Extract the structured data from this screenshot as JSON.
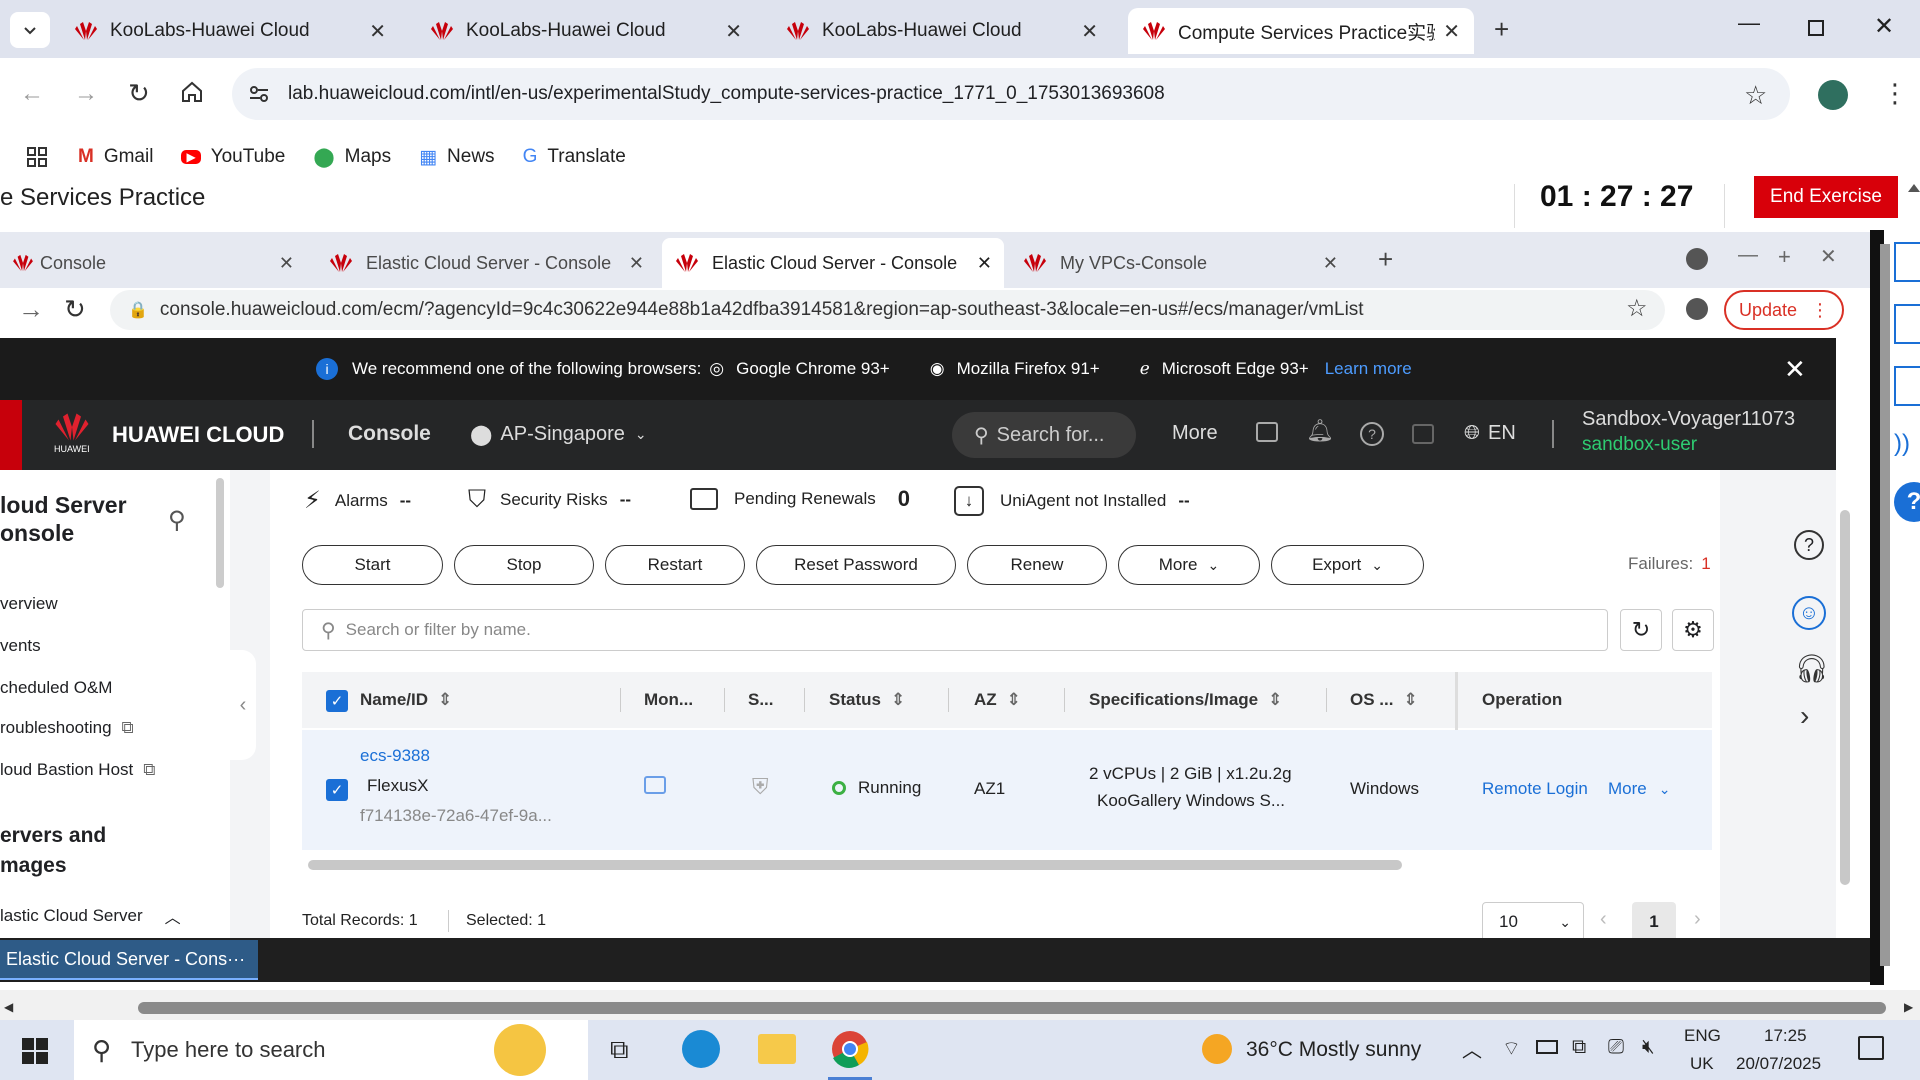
{
  "outer_tabs": [
    {
      "title": "KooLabs-Huawei Cloud"
    },
    {
      "title": "KooLabs-Huawei Cloud"
    },
    {
      "title": "KooLabs-Huawei Cloud"
    },
    {
      "title": "Compute Services Practice实验"
    }
  ],
  "outer_url": "lab.huaweicloud.com/intl/en-us/experimentalStudy_compute-services-practice_1771_0_1753013693608",
  "bookmarks": [
    "Gmail",
    "YouTube",
    "Maps",
    "News",
    "Translate"
  ],
  "lab": {
    "title": "e Services Practice",
    "timer": "01 : 27 : 27",
    "end_button": "End Exercise"
  },
  "inner_tabs": [
    {
      "title": "Console"
    },
    {
      "title": "Elastic Cloud Server - Console"
    },
    {
      "title": "Elastic Cloud Server - Console"
    },
    {
      "title": "My VPCs-Console"
    }
  ],
  "inner_url": "console.huaweicloud.com/ecm/?agencyId=9c4c30622e944e88b1a42dfba3914581&region=ap-southeast-3&locale=en-us#/ecs/manager/vmList",
  "update_label": "Update",
  "recommend": {
    "text": "We recommend one of the following browsers:",
    "browsers": [
      "Google Chrome 93+",
      "Mozilla Firefox 91+",
      "Microsoft Edge 93+"
    ],
    "learn_more": "Learn more"
  },
  "hwnav": {
    "brand": "HUAWEI CLOUD",
    "logo_text": "HUAWEI",
    "console": "Console",
    "region": "AP-Singapore",
    "search": "Search for...",
    "more": "More",
    "lang": "EN",
    "account": "Sandbox-Voyager11073",
    "user": "sandbox-user"
  },
  "sidebar": {
    "title_line1": "loud Server",
    "title_line2": "onsole",
    "items": [
      "verview",
      "vents",
      "cheduled O&M",
      "roubleshooting",
      "loud Bastion Host"
    ],
    "section_line1": "ervers and",
    "section_line2": "mages",
    "sub": "lastic Cloud Server"
  },
  "summary": {
    "alarms": "Alarms",
    "alarms_val": "--",
    "security": "Security Risks",
    "security_val": "--",
    "renewals": "Pending Renewals",
    "renewals_val": "0",
    "agent": "UniAgent not Installed",
    "agent_val": "--"
  },
  "buttons": [
    "Start",
    "Stop",
    "Restart",
    "Reset Password",
    "Renew",
    "More",
    "Export"
  ],
  "failures_label": "Failures:",
  "failures_val": "1",
  "filter_placeholder": "Search or filter by name.",
  "columns": [
    "Name/ID",
    "Mon...",
    "S...",
    "Status",
    "AZ",
    "Specifications/Image",
    "OS ...",
    "Operation"
  ],
  "row": {
    "name": "ecs-9388",
    "alias": "FlexusX",
    "id": "f714138e-72a6-47ef-9a...",
    "status": "Running",
    "az": "AZ1",
    "spec1": "2 vCPUs | 2 GiB | x1.2u.2g",
    "spec2": "KooGallery  Windows S...",
    "os": "Windows",
    "remote": "Remote Login",
    "more": "More"
  },
  "footer": {
    "total": "Total Records: 1",
    "selected": "Selected: 1",
    "page_size": "10",
    "page": "1"
  },
  "inner_taskbar_item": "Elastic Cloud Server - Cons···",
  "taskbar": {
    "search": "Type here to search",
    "weather": "36°C  Mostly sunny",
    "lang1": "ENG",
    "lang2": "UK",
    "time": "17:25",
    "date": "20/07/2025"
  },
  "colors": {
    "accent": "#1a6fd6",
    "huawei_red": "#c7000b",
    "running": "#3cb043"
  }
}
